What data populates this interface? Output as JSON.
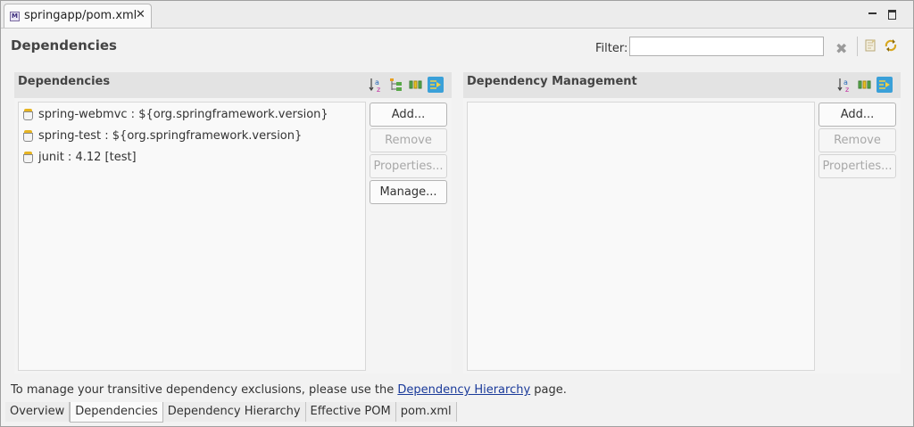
{
  "editor_tab": {
    "label": "springapp/pom.xml",
    "icon": "maven-pom-icon"
  },
  "page": {
    "title": "Dependencies",
    "filter_label": "Filter:",
    "filter_value": ""
  },
  "dependencies": {
    "title": "Dependencies",
    "items": [
      "spring-webmvc : ${org.springframework.version}",
      "spring-test : ${org.springframework.version}",
      "junit : 4.12 [test]"
    ],
    "buttons": {
      "add": "Add...",
      "remove": "Remove",
      "properties": "Properties...",
      "manage": "Manage..."
    }
  },
  "dependency_management": {
    "title": "Dependency Management",
    "buttons": {
      "add": "Add...",
      "remove": "Remove",
      "properties": "Properties..."
    }
  },
  "hint": {
    "before": "To manage your transitive dependency exclusions, please use the ",
    "link": "Dependency Hierarchy",
    "after": " page."
  },
  "bottom_tabs": [
    "Overview",
    "Dependencies",
    "Dependency Hierarchy",
    "Effective POM",
    "pom.xml"
  ],
  "active_bottom_tab": "Dependencies",
  "colors": {
    "toggle_active": "#3aa0d8",
    "link": "#1a3a9a"
  }
}
